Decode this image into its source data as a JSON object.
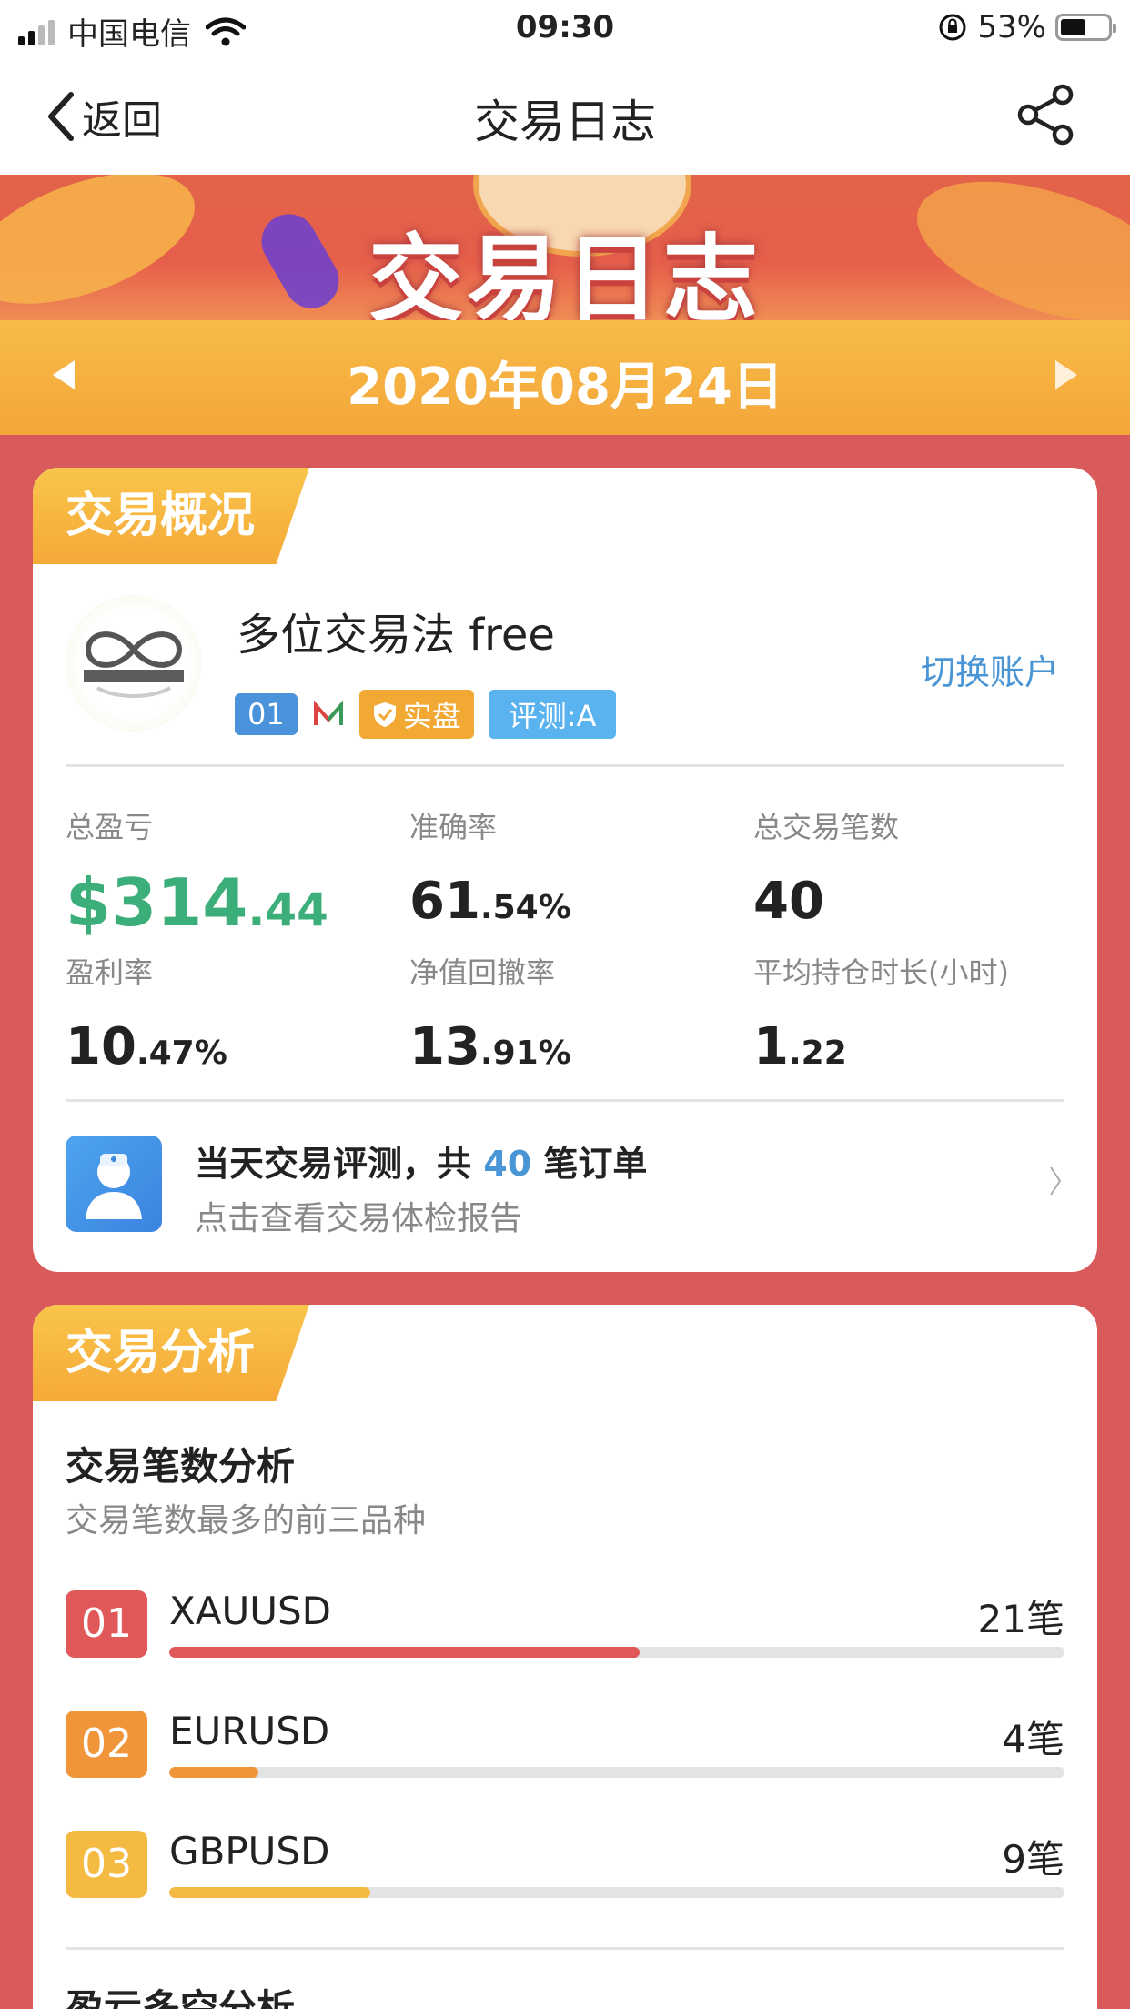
{
  "status_bar": {
    "carrier": "中国电信",
    "time": "09:30",
    "battery": "53%",
    "battery_level": 0.53
  },
  "nav": {
    "back_label": "返回",
    "title": "交易日志"
  },
  "banner": {
    "title": "交易日志"
  },
  "date_bar": {
    "date": "2020年08月24日"
  },
  "overview": {
    "tag": "交易概况",
    "account_name": "多位交易法 free",
    "account_no": "01",
    "real_label": "实盘",
    "eval_label": "评测:A",
    "switch_label": "切换账户",
    "stats": [
      {
        "label": "总盈亏",
        "main": "$314",
        "dec": ".44"
      },
      {
        "label": "准确率",
        "main": "61",
        "dec": ".54%"
      },
      {
        "label": "总交易笔数",
        "main": "40",
        "dec": ""
      },
      {
        "label": "盈利率",
        "main": "10",
        "dec": ".47%"
      },
      {
        "label": "净值回撤率",
        "main": "13",
        "dec": ".91%"
      },
      {
        "label": "平均持仓时长(小时)",
        "main": "1",
        "dec": ".22"
      }
    ],
    "report": {
      "title_pre": "当天交易评测，共",
      "count": "40",
      "title_post": "笔订单",
      "subtitle": "点击查看交易体检报告"
    }
  },
  "analysis": {
    "tag": "交易分析",
    "section_title": "交易笔数分析",
    "section_sub": "交易笔数最多的前三品种",
    "ranks": [
      {
        "rank": "01",
        "symbol": "XAUUSD",
        "count": "21笔",
        "share": 0.525,
        "color": "#e05858"
      },
      {
        "rank": "02",
        "symbol": "EURUSD",
        "count": "4笔",
        "share": 0.1,
        "color": "#f0953a"
      },
      {
        "rank": "03",
        "symbol": "GBPUSD",
        "count": "9笔",
        "share": 0.225,
        "color": "#f5ba42"
      }
    ],
    "section2_title": "盈亏多空分析"
  }
}
